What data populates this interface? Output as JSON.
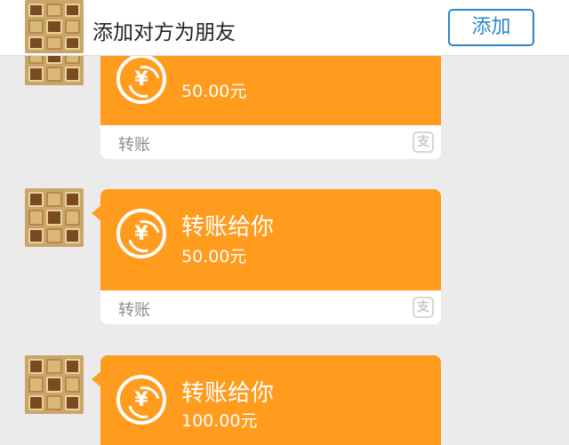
{
  "header": {
    "prompt": "添加对方为朋友",
    "add_button": "添加"
  },
  "messages": [
    {
      "title": "",
      "amount": "50.00元",
      "footer": "转账",
      "coin_symbol": "¥",
      "pay_icon": "支"
    },
    {
      "title": "转账给你",
      "amount": "50.00元",
      "footer": "转账",
      "coin_symbol": "¥",
      "pay_icon": "支"
    },
    {
      "title": "转账给你",
      "amount": "100.00元",
      "footer": "",
      "coin_symbol": "¥",
      "pay_icon": ""
    }
  ],
  "colors": {
    "transfer_orange": "#ff9c1e",
    "add_button_blue": "#2f86c8",
    "background": "#ebebeb"
  },
  "icons": {
    "coin": "yuan-coin-icon",
    "pay": "alipay-icon"
  }
}
